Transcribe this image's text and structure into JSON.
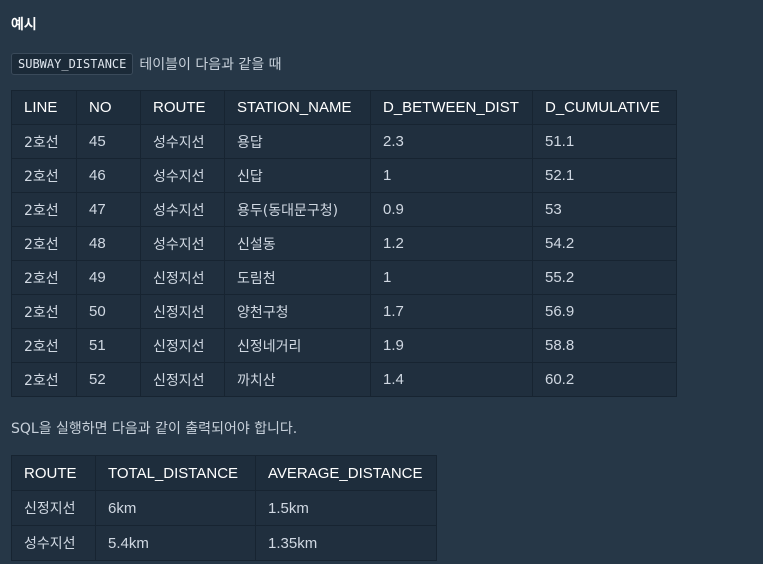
{
  "heading": "예시",
  "intro": {
    "code": "SUBWAY_DISTANCE",
    "text": "테이블이 다음과 같을 때"
  },
  "input_table": {
    "columns": [
      "LINE",
      "NO",
      "ROUTE",
      "STATION_NAME",
      "D_BETWEEN_DIST",
      "D_CUMULATIVE"
    ],
    "rows": [
      [
        "2호선",
        "45",
        "성수지선",
        "용답",
        "2.3",
        "51.1"
      ],
      [
        "2호선",
        "46",
        "성수지선",
        "신답",
        "1",
        "52.1"
      ],
      [
        "2호선",
        "47",
        "성수지선",
        "용두(동대문구청)",
        "0.9",
        "53"
      ],
      [
        "2호선",
        "48",
        "성수지선",
        "신설동",
        "1.2",
        "54.2"
      ],
      [
        "2호선",
        "49",
        "신정지선",
        "도림천",
        "1",
        "55.2"
      ],
      [
        "2호선",
        "50",
        "신정지선",
        "양천구청",
        "1.7",
        "56.9"
      ],
      [
        "2호선",
        "51",
        "신정지선",
        "신정네거리",
        "1.9",
        "58.8"
      ],
      [
        "2호선",
        "52",
        "신정지선",
        "까치산",
        "1.4",
        "60.2"
      ]
    ]
  },
  "note": "SQL을 실행하면 다음과 같이 출력되어야 합니다.",
  "result_table": {
    "columns": [
      "ROUTE",
      "TOTAL_DISTANCE",
      "AVERAGE_DISTANCE"
    ],
    "rows": [
      [
        "신정지선",
        "6km",
        "1.5km"
      ],
      [
        "성수지선",
        "5.4km",
        "1.35km"
      ]
    ]
  }
}
